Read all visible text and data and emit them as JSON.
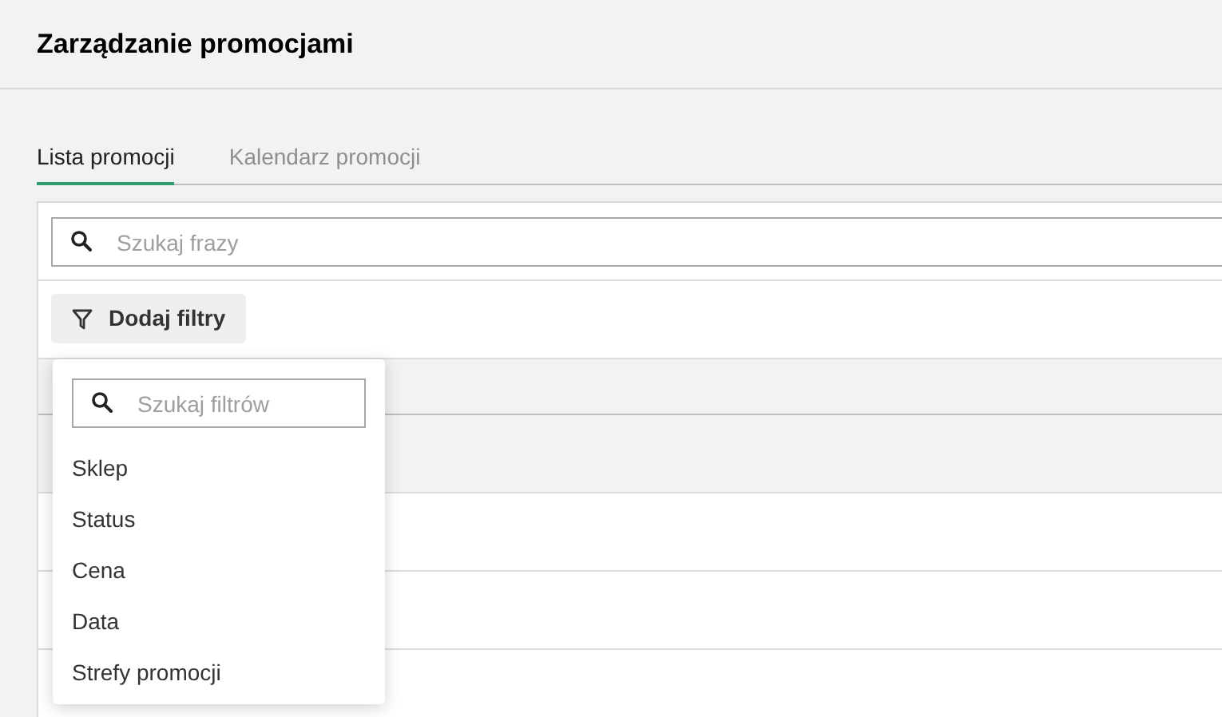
{
  "page": {
    "title": "Zarządzanie promocjami"
  },
  "tabs": [
    {
      "label": "Lista promocji",
      "selected": true
    },
    {
      "label": "Kalendarz promocji",
      "selected": false
    }
  ],
  "search": {
    "placeholder": "Szukaj frazy"
  },
  "filter_button": {
    "label": "Dodaj filtry"
  },
  "filter_menu": {
    "search": {
      "placeholder": "Szukaj filtrów"
    },
    "items": [
      {
        "label": "Sklep"
      },
      {
        "label": "Status"
      },
      {
        "label": "Cena"
      },
      {
        "label": "Data"
      },
      {
        "label": "Strefy promocji"
      }
    ]
  }
}
